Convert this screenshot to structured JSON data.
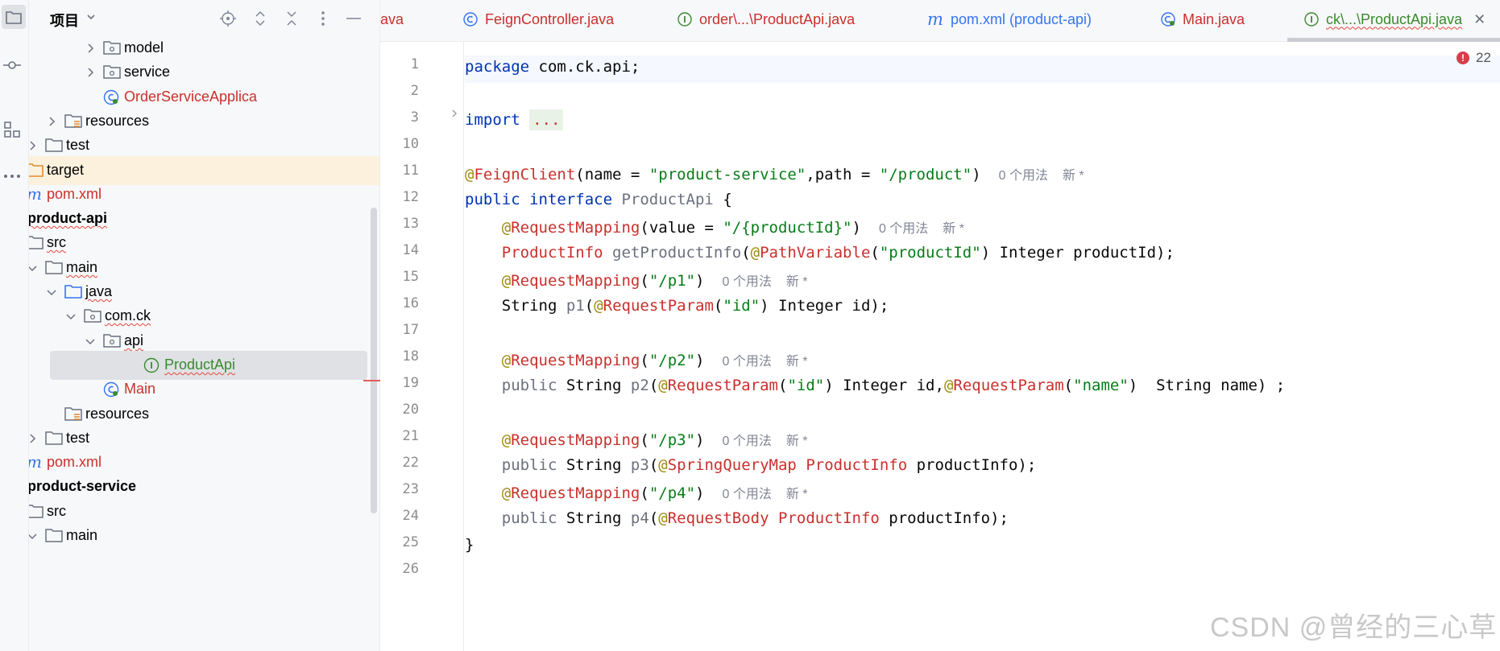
{
  "colors": {
    "accent": "#3574f0",
    "error": "#db3b4b",
    "target_highlight": "#fcf1dc",
    "selection": "#dfe1e5"
  },
  "project": {
    "title": "项目",
    "tree": [
      {
        "label": "model",
        "icon": "package-folder-icon",
        "expanded": false
      },
      {
        "label": "service",
        "icon": "package-folder-icon",
        "expanded": false
      },
      {
        "label": "OrderServiceApplica",
        "icon": "spring-boot-class-icon"
      },
      {
        "label": "resources",
        "icon": "resources-folder-icon",
        "expanded": false
      },
      {
        "label": "test",
        "icon": "folder-icon",
        "expanded": false
      },
      {
        "label": "target",
        "icon": "excluded-folder-icon",
        "expanded": false
      },
      {
        "label": "pom.xml",
        "icon": "maven-icon"
      },
      {
        "label": "product-api",
        "icon": "module-icon",
        "expanded": true
      },
      {
        "label": "src",
        "icon": "folder-icon",
        "expanded": true
      },
      {
        "label": "main",
        "icon": "folder-icon",
        "expanded": true
      },
      {
        "label": "java",
        "icon": "source-root-icon",
        "expanded": true
      },
      {
        "label": "com.ck",
        "icon": "package-folder-icon",
        "expanded": true
      },
      {
        "label": "api",
        "icon": "package-folder-icon",
        "expanded": true
      },
      {
        "label": "ProductApi",
        "icon": "interface-icon",
        "selected": true
      },
      {
        "label": "Main",
        "icon": "spring-boot-class-icon"
      },
      {
        "label": "resources",
        "icon": "resources-folder-icon"
      },
      {
        "label": "test",
        "icon": "folder-icon",
        "expanded": false
      },
      {
        "label": "pom.xml",
        "icon": "maven-icon"
      },
      {
        "label": "product-service",
        "icon": "module-icon",
        "expanded": true
      },
      {
        "label": "src",
        "icon": "folder-icon",
        "expanded": true
      },
      {
        "label": "main",
        "icon": "folder-icon",
        "expanded": true
      }
    ]
  },
  "tabs": [
    {
      "label": "ava",
      "icon": ""
    },
    {
      "label": "FeignController.java",
      "icon": "class-icon"
    },
    {
      "label": "order\\...\\ProductApi.java",
      "icon": "interface-icon"
    },
    {
      "label": "pom.xml (product-api)",
      "icon": "maven-icon"
    },
    {
      "label": "Main.java",
      "icon": "spring-boot-class-icon"
    },
    {
      "label": "ck\\...\\ProductApi.java",
      "icon": "interface-icon",
      "active": true
    }
  ],
  "editor": {
    "error_count": "22",
    "line_numbers": [
      "1",
      "2",
      "3",
      "10",
      "11",
      "12",
      "13",
      "14",
      "15",
      "16",
      "17",
      "18",
      "19",
      "20",
      "21",
      "22",
      "23",
      "24",
      "25",
      "26"
    ],
    "hint_usages": "0 个用法",
    "hint_new": "新 *",
    "fold_placeholder": "...",
    "code": {
      "l1_kw": "package",
      "l1_rest": " com.ck.api;",
      "l3_kw": "import",
      "l11_at": "@",
      "l11_ann": "FeignClient",
      "l11_a": "(name = ",
      "l11_s1": "\"product-service\"",
      "l11_b": ",path = ",
      "l11_s2": "\"/product\"",
      "l11_c": ")",
      "l12_kw": "public interface",
      "l12_name": " ProductApi",
      "l12_rest": " {",
      "l13_ann": "RequestMapping",
      "l13_a": "(value = ",
      "l13_s": "\"/{productId}\"",
      "l13_b": ")",
      "l14_type": "ProductInfo",
      "l14_m": " getProductInfo",
      "l14_a": "(",
      "l14_ann": "PathVariable",
      "l14_b": "(",
      "l14_s": "\"productId\"",
      "l14_c": ") Integer productId);",
      "l15_ann": "RequestMapping",
      "l15_s": "\"/p1\"",
      "l16_a": "String",
      "l16_m": " p1",
      "l16_b": "(",
      "l16_ann": "RequestParam",
      "l16_s": "\"id\"",
      "l16_c": ") Integer id);",
      "l18_ann": "RequestMapping",
      "l18_s": "\"/p2\"",
      "l19_kw": "public",
      "l19_a": " String",
      "l19_m": " p2",
      "l19_b": "(",
      "l19_ann1": "RequestParam",
      "l19_s1": "\"id\"",
      "l19_c": ") Integer id,",
      "l19_ann2": "RequestParam",
      "l19_s2": "\"name\"",
      "l19_d": ")  String name) ;",
      "l21_ann": "RequestMapping",
      "l21_s": "\"/p3\"",
      "l22_kw": "public",
      "l22_a": " String",
      "l22_m": " p3",
      "l22_b": "(",
      "l22_ann": "SpringQueryMap",
      "l22_type": " ProductInfo",
      "l22_c": " productInfo);",
      "l23_ann": "RequestMapping",
      "l23_s": "\"/p4\"",
      "l24_kw": "public",
      "l24_a": " String",
      "l24_m": " p4",
      "l24_b": "(",
      "l24_ann": "RequestBody",
      "l24_type": " ProductInfo",
      "l24_c": " productInfo);",
      "l25": "}"
    }
  },
  "watermark": "CSDN @曾经的三心草"
}
